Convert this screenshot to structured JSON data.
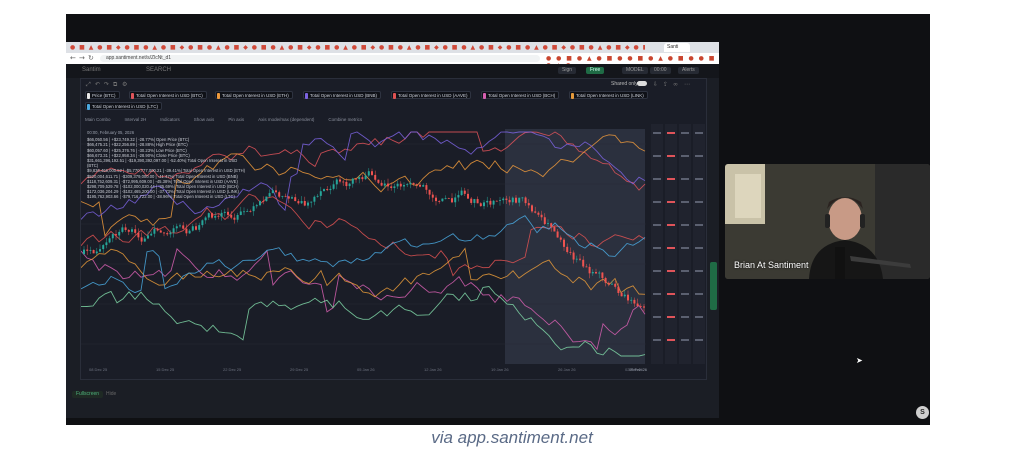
{
  "caption": "via app.santiment.net",
  "browser": {
    "tab_label": "Santi",
    "url": "app.santiment.net/s/ZlcNt_d1"
  },
  "app": {
    "logo": "Santim",
    "nav_search": "SEARCH",
    "buttons": [
      "Sign",
      "Free"
    ],
    "right_labels": [
      "MODEL",
      "00:00",
      "Alerts"
    ]
  },
  "toolbar": {
    "shared_label": "Shared only"
  },
  "metrics": [
    {
      "label": "Price (BTC)",
      "color": "#e9e9e9"
    },
    {
      "label": "Total Open Interest in USD (BTC)",
      "color": "#e0545a"
    },
    {
      "label": "Total Open Interest in USD (ETH)",
      "color": "#ef9a3c"
    },
    {
      "label": "Total Open Interest in USD (BNB)",
      "color": "#7b63e0"
    },
    {
      "label": "Total Open Interest in USD (AAVE)",
      "color": "#e05252"
    },
    {
      "label": "Total Open Interest in USD (BCH)",
      "color": "#d65fb0"
    },
    {
      "label": "Total Open Interest in USD (LINK)",
      "color": "#e69a3a"
    },
    {
      "label": "Total Open Interest in USD (LTC)",
      "color": "#4aa9e0"
    }
  ],
  "options": [
    "Main Combo",
    "Interval 2H",
    "Indicators",
    "Show axis",
    "Pin axis",
    "Axis mode/max (dependent)",
    "Combine metrics"
  ],
  "legend": {
    "date": "00:00, February 05, 2026",
    "rows": [
      "$66,050.56 | +$23,749.32 | -28.77%| Open Price (BTC)",
      "$66,475.21 | +$22,256.89 | -28.88%| High Price (BTC)",
      "$60,057.60 | +$25,376.76 | -30.23%| Low Price (BTC)",
      "$66,673.31 | +$22,958.34 | -28.90%| Close Price (BTC)",
      "$31,661,396,192.51 | -$19,390,392,097.00 | -52.40%| Total Open Interest in USD (BTC)",
      "$9,836,466,000.52 | -$5,770,777,000.21 | -39.41%| Total Open Interest in USD (ETH)",
      "$520,004,611.71 | -$309,379,000.00 | -41.47%| Total Open Interest in USD (BNB)",
      "$118,752,609.31 | -$72,995,609.00 | -45.38%| Total Open Interest in USD (AAVE)",
      "$298,709,529.78 | -$102,000,020.44 | -35.69%| Total Open Interest in USD (BCH)",
      "$172,036,204.29 | -$102,465,200.00 | -37.73%| Total Open Interest in USD (LINK)",
      "$195,762,903.66 | -$79,716,722.00 | -38.96%| Total Open Interest in USD (LTC)"
    ]
  },
  "date_ticks": [
    "08 Dec 25",
    "15 Dec 25",
    "22 Dec 25",
    "29 Dec 25",
    "05 Jan 26",
    "12 Jan 26",
    "19 Jan 26",
    "26 Jan 26",
    "02 Feb 26"
  ],
  "date_marker": "05 Feb 26",
  "bottom": {
    "left_button": "Fullscreen",
    "right_label": "Hide"
  },
  "webcam": {
    "name": "Brian At Santiment"
  },
  "badge": "S"
}
